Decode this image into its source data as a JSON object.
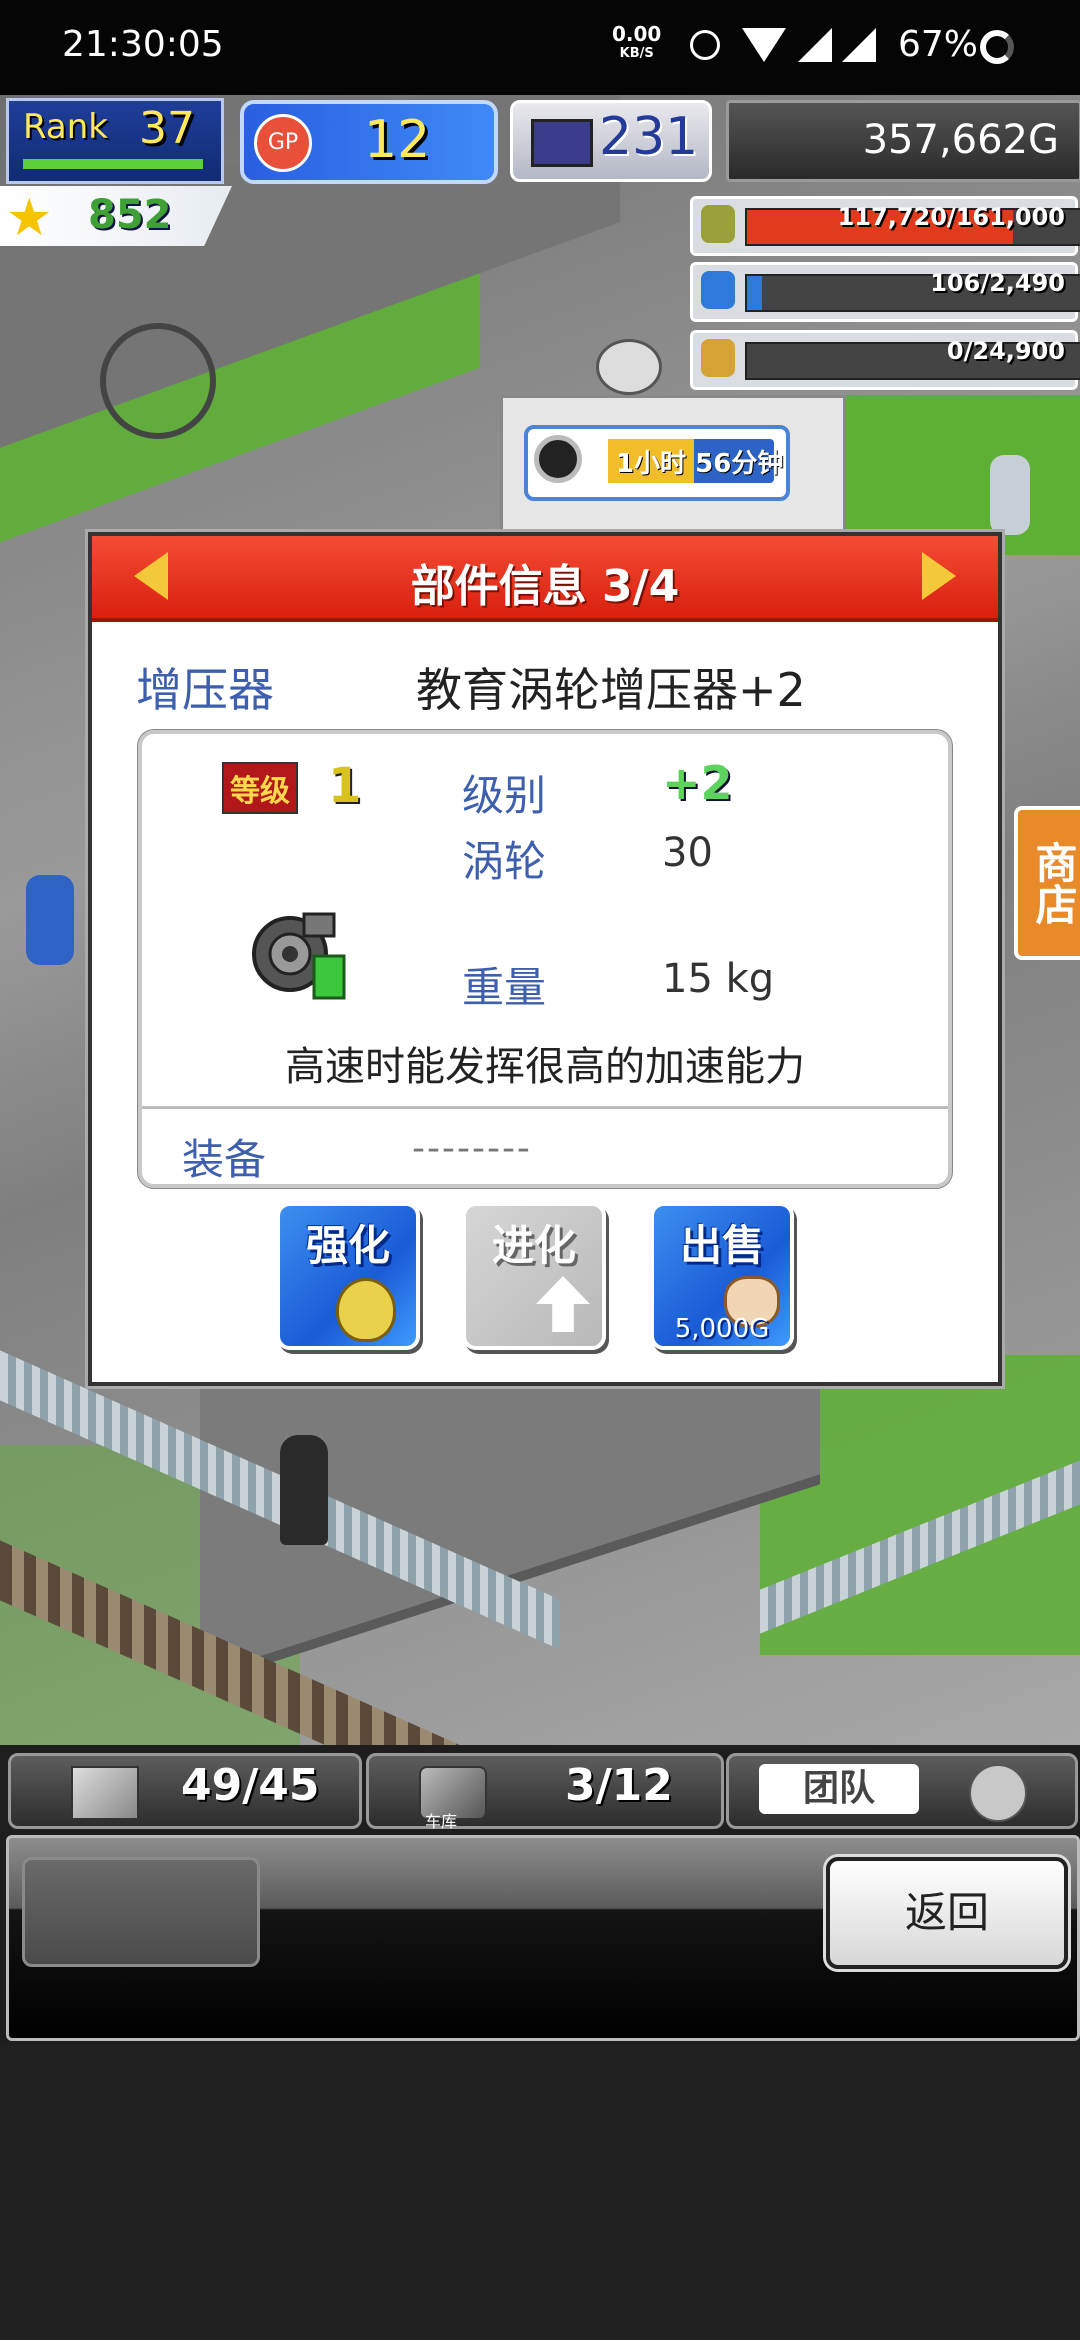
{
  "status_bar": {
    "time": "21:30:05",
    "net_speed": "0.00",
    "net_unit": "KB/S",
    "battery": "67%"
  },
  "hud": {
    "rank_label": "Rank",
    "rank_value": "37",
    "gp_label": "GP",
    "gp_value": "12",
    "pc_value": "231",
    "money": "357,662G",
    "stars": "852"
  },
  "resources": [
    {
      "text": "117,720/161,000",
      "fill": 0.73,
      "color": "#e23a1c"
    },
    {
      "text": "106/2,490",
      "fill": 0.04,
      "color": "#2f7ad8"
    },
    {
      "text": "0/24,900",
      "fill": 0.0,
      "color": "#a7b12b"
    }
  ],
  "timer": {
    "text": "1小时 56分钟"
  },
  "shop_sign": "商店",
  "dialog": {
    "title": "部件信息 3/4",
    "category": "增压器",
    "part_name": "教育涡轮增压器+2",
    "level_badge": "等级",
    "level_value": "1",
    "stats": {
      "grade_label": "级别",
      "grade_value": "+2",
      "turbo_label": "涡轮",
      "turbo_value": "30",
      "weight_label": "重量",
      "weight_value": "15 kg"
    },
    "description": "高速时能发挥很高的加速能力",
    "equip_label": "装备",
    "equip_value": "--------",
    "buttons": {
      "enhance": "强化",
      "evolve": "进化",
      "sell": "出售",
      "sell_price": "5,000G"
    }
  },
  "bottom": {
    "items_count": "49/45",
    "garage_count": "3/12",
    "garage_label": "车库",
    "team_label": "团队",
    "back_label": "返回"
  },
  "colors": {
    "header_red": "#e0301a",
    "button_blue": "#2a6fe0",
    "accent_yellow": "#f3c93a"
  }
}
